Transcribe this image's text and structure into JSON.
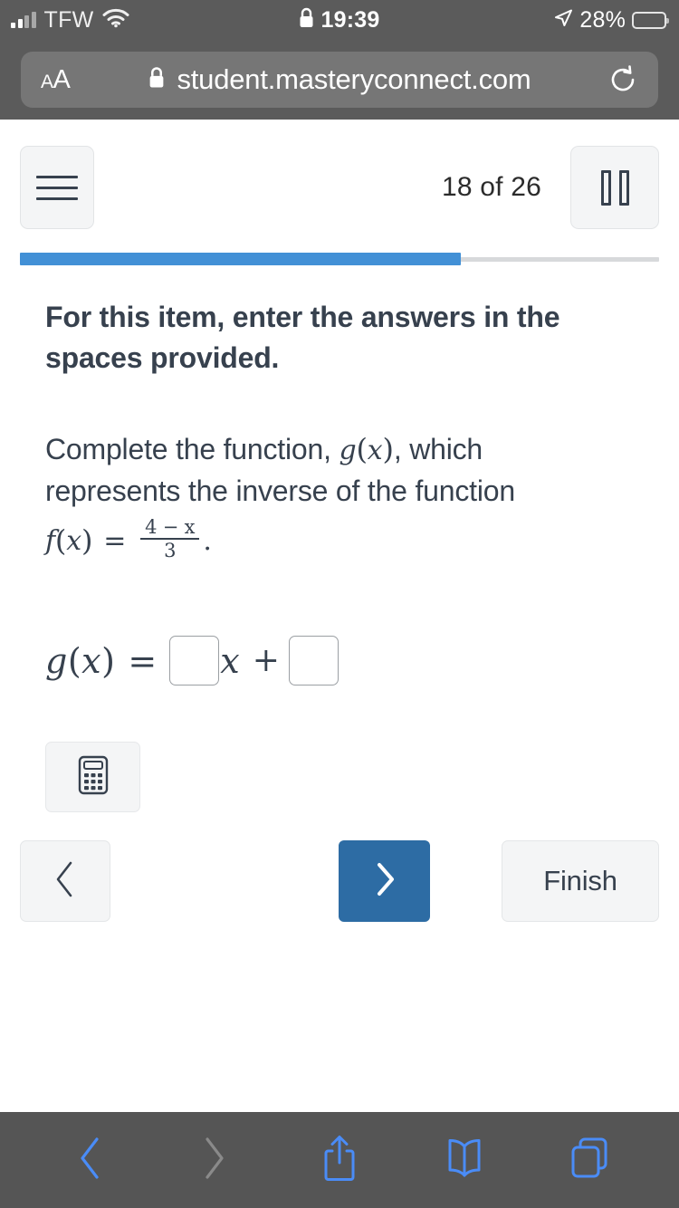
{
  "status_bar": {
    "carrier": "TFW",
    "time": "19:39",
    "battery_percent": "28%",
    "battery_level": 28,
    "signal_icon": "cellular-signal-icon",
    "wifi_icon": "wifi-icon",
    "lock_icon": "lock-icon",
    "location_icon": "location-arrow-icon",
    "battery_icon": "battery-icon"
  },
  "browser": {
    "text_size_label": "AA",
    "url": "student.masteryconnect.com",
    "lock_icon": "lock-icon",
    "reload_icon": "reload-icon",
    "toolbar": [
      {
        "name": "back-button",
        "icon": "chevron-left-icon",
        "enabled": true
      },
      {
        "name": "forward-button",
        "icon": "chevron-right-icon",
        "enabled": false
      },
      {
        "name": "share-button",
        "icon": "share-icon",
        "enabled": true
      },
      {
        "name": "bookmarks-button",
        "icon": "book-icon",
        "enabled": true
      },
      {
        "name": "tabs-button",
        "icon": "tabs-icon",
        "enabled": true
      }
    ],
    "accent_color": "#4a8cf7",
    "disabled_color": "#8a8a8a",
    "bar_color": "#555555"
  },
  "assessment": {
    "menu_icon": "hamburger-menu-icon",
    "pause_icon": "pause-icon",
    "question_counter": "18 of 26",
    "current_question": 18,
    "total_questions": 26,
    "progress_percent": 69,
    "progress_color": "#4290d6",
    "progress_track_color": "#d7d9db"
  },
  "question": {
    "directions": "For this item, enter the answers in the spaces provided.",
    "prompt_part1": "Complete the function, ",
    "prompt_g": "g",
    "prompt_gx_open": "(",
    "prompt_gx_var": "x",
    "prompt_gx_close": ")",
    "prompt_part2": ", which represents the inverse of the function",
    "fx_f": "f",
    "fx_open": "(",
    "fx_var": "x",
    "fx_close": ")",
    "fx_equals": "=",
    "fx_numerator": "4 − x",
    "fx_denominator": "3",
    "fx_period": "."
  },
  "answer": {
    "label_g": "g",
    "label_open": "(",
    "label_var": "x",
    "label_close": ")",
    "equals": "=",
    "slope_value": "",
    "slope_placeholder": "",
    "variable": "x",
    "operator": "+",
    "intercept_value": "",
    "intercept_placeholder": ""
  },
  "tools": {
    "calculator_icon": "calculator-icon"
  },
  "navigation": {
    "previous_icon": "chevron-left-icon",
    "next_icon": "chevron-right-icon",
    "finish_label": "Finish",
    "next_button_color": "#2d6ca4"
  }
}
